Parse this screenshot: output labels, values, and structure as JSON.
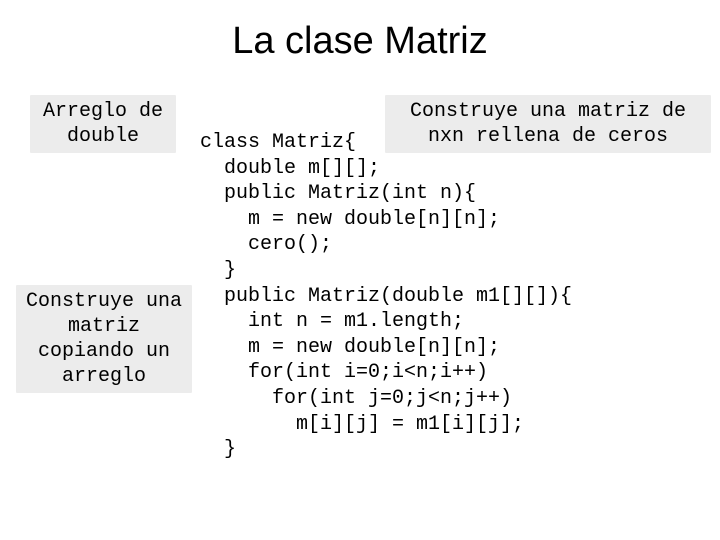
{
  "title": "La clase Matriz",
  "labels": {
    "arr_double": "Arreglo de\ndouble",
    "copy_arr": "Construye una\nmatriz\ncopiando un\narreglo",
    "zeros": "Construye una matriz\nde nxn rellena de ceros"
  },
  "code": "class Matriz{\n  double m[][];\n  public Matriz(int n){\n    m = new double[n][n];\n    cero();\n  }\n  public Matriz(double m1[][]){\n    int n = m1.length;\n    m = new double[n][n];\n    for(int i=0;i<n;i++)\n      for(int j=0;j<n;j++)\n        m[i][j] = m1[i][j];\n  }"
}
